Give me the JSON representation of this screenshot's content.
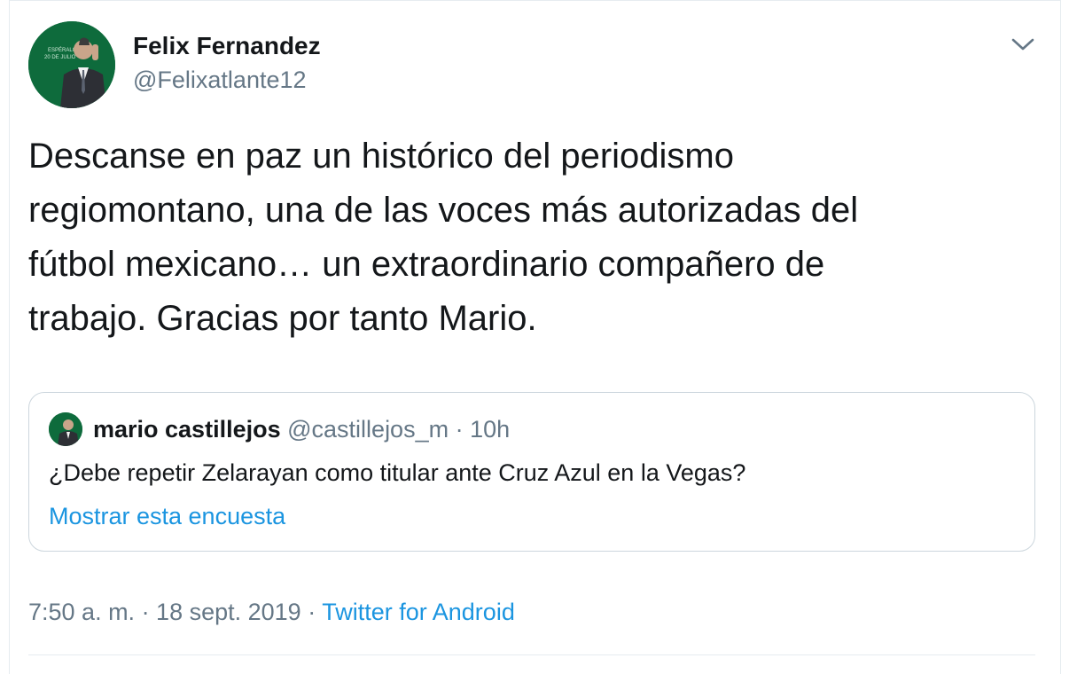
{
  "tweet": {
    "author": {
      "name": "Felix Fernandez",
      "handle": "@Felixatlante12",
      "avatar_text": "ESPÉRALO 20 DE JULIO"
    },
    "text": "Descanse en paz un histórico del periodismo\nregiomontano, una de las voces más autorizadas del\nfútbol mexicano… un extraordinario compañero de\ntrabajo. Gracias por tanto Mario.",
    "quoted": {
      "name": "mario castillejos",
      "handle": "@castillejos_m",
      "separator": "·",
      "time": "10h",
      "text": "¿Debe repetir Zelarayan como titular ante Cruz Azul en la Vegas?",
      "link_label": "Mostrar esta encuesta"
    },
    "timestamp": "7:50 a. m. · 18 sept. 2019",
    "separator": "·",
    "source": "Twitter for Android"
  },
  "colors": {
    "text": "#14171a",
    "secondary": "#657786",
    "link": "#1b95e0",
    "border": "#ccd6dd",
    "avatar_bg": "#0e6b3c"
  },
  "icons": {
    "menu": "chevron-down-icon"
  }
}
